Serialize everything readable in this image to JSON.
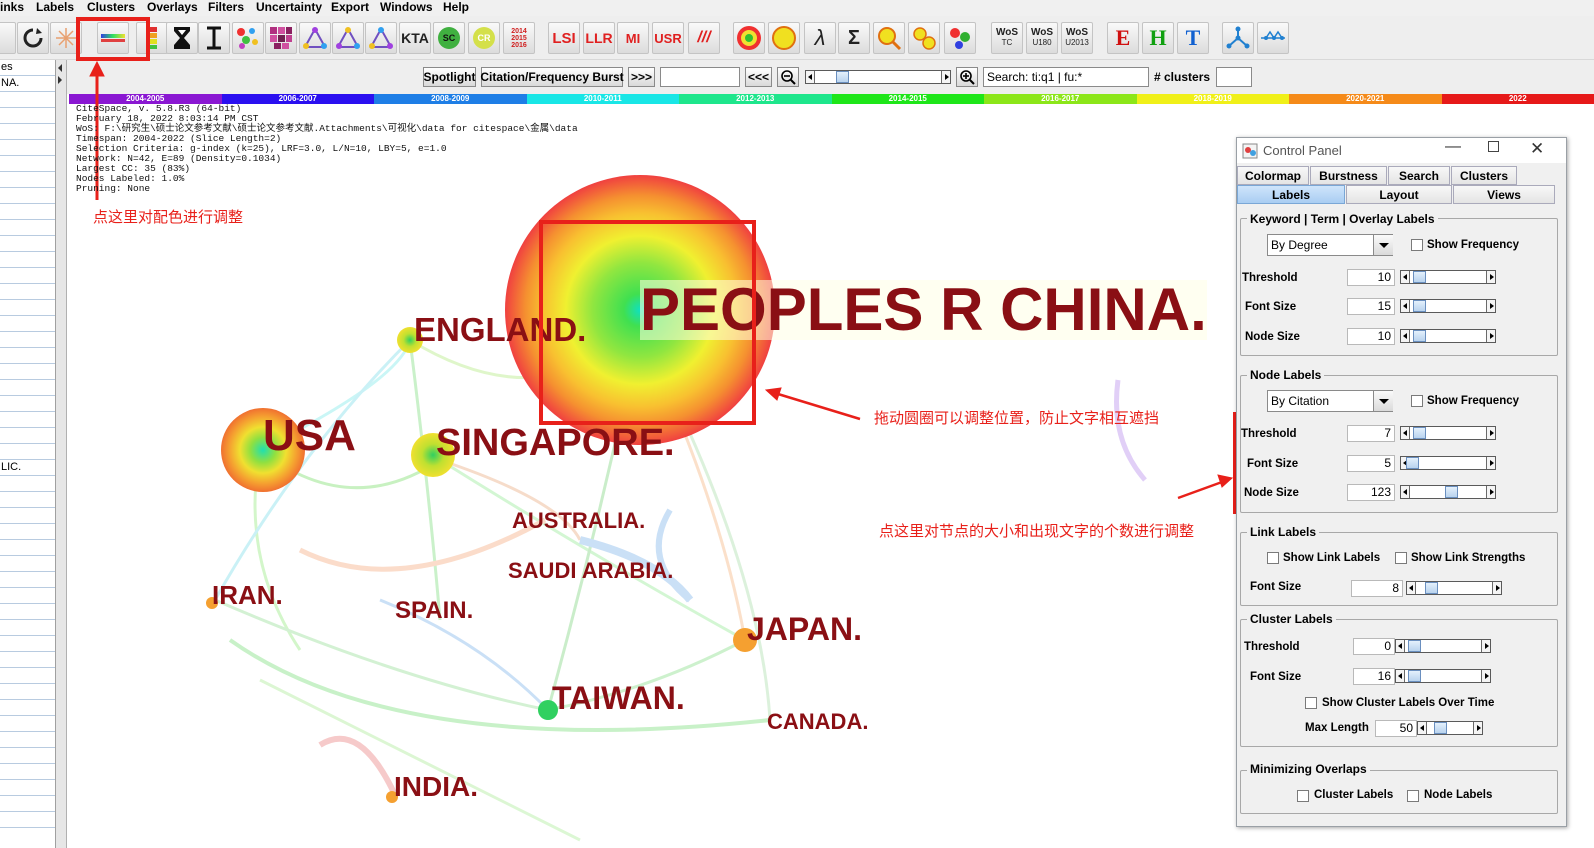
{
  "menu": [
    "inks",
    "Labels",
    "Clusters",
    "Overlays",
    "Filters",
    "Uncertainty",
    "Export",
    "Windows",
    "Help"
  ],
  "toolbar": {
    "buttons": [
      {
        "id": "refresh-button",
        "icon": "refresh-icon"
      },
      {
        "id": "sparkle-button",
        "icon": "sparkle-icon"
      },
      {
        "id": "colormap-button",
        "icon": "colormap-icon"
      },
      {
        "id": "palette-button",
        "icon": "palette-icon"
      },
      {
        "id": "hourglass-button",
        "icon": "hourglass-icon"
      },
      {
        "id": "ibeam-button",
        "icon": "ibeam-icon"
      },
      {
        "id": "scatter-button",
        "icon": "scatter-icon"
      },
      {
        "id": "grid-button",
        "icon": "grid-icon"
      },
      {
        "id": "tri1-button",
        "icon": "triangle-network-icon"
      },
      {
        "id": "tri2-button",
        "icon": "triangle-network-icon"
      },
      {
        "id": "tri3-button",
        "icon": "triangle-network-icon"
      },
      {
        "id": "kta-button",
        "icon": "kta-icon"
      },
      {
        "id": "sc-button",
        "icon": "sc-icon"
      },
      {
        "id": "cr-button",
        "icon": "cr-icon"
      },
      {
        "id": "timeline-button",
        "icon": "timeline-icon"
      }
    ],
    "kta_label": "KTA",
    "sc_label": "SC",
    "cr_label": "CR",
    "timeline_label": "2014\n2015\n2016",
    "lsi_label": "LSI",
    "llr_label": "LLR",
    "mi_label": "MI",
    "usr_label": "USR",
    "slash_label": "///",
    "lambda_label": "λ",
    "sigma_label": "Σ",
    "wos_tc_label": [
      "WoS",
      "TC"
    ],
    "wos_u180_label": [
      "WoS",
      "U180"
    ],
    "wos_u2013_label": [
      "WoS",
      "U2013"
    ],
    "e_label": "E",
    "h_label": "H",
    "t_label": "T"
  },
  "left_panel": {
    "rows": [
      "es",
      "NA.",
      "",
      "",
      "",
      "",
      "",
      "",
      "",
      "",
      "",
      "",
      "",
      "",
      "",
      "",
      "",
      "",
      "",
      "",
      "",
      "",
      "",
      "",
      "",
      "LIC.",
      "",
      "",
      "",
      "",
      "",
      "",
      "",
      "",
      "",
      "",
      "",
      "",
      "",
      "",
      "",
      "",
      "",
      "",
      "",
      "",
      "",
      ""
    ]
  },
  "nav": {
    "spotlight": "Spotlight",
    "burst": "Citation/Frequency Burst",
    "forward": ">>>",
    "back": "<<<",
    "search_value": "Search: ti:q1 | fu:*",
    "clusters_label": "# clusters"
  },
  "years": [
    "2004-2005",
    "2006-2007",
    "2008-2009",
    "2010-2011",
    "2012-2013",
    "2014-2015",
    "2016-2017",
    "2018-2019",
    "2020-2021",
    "2022"
  ],
  "year_colors": [
    "#8a17d2",
    "#2a0ff0",
    "#1e7ee6",
    "#19e6e6",
    "#1ee68c",
    "#1ee619",
    "#8ce619",
    "#f0f019",
    "#f58a19",
    "#e61919"
  ],
  "info_lines": [
    "CiteSpace, v. 5.8.R3 (64-bit)",
    "February 18, 2022 8:03:14 PM CST",
    "WoS: F:\\研究生\\硕士论文参考文献\\硕士论文参考文献.Attachments\\可视化\\data for citespace\\金属\\data",
    "Timespan: 2004-2022 (Slice Length=2)",
    "Selection Criteria: g-index (k=25), LRF=3.0, L/N=10, LBY=5, e=1.0",
    "Network: N=42, E=89 (Density=0.1034)",
    "Largest CC: 35 (83%)",
    "Nodes Labeled: 1.0%",
    "Pruning: None"
  ],
  "annotations": {
    "colormap_hint": "点这里对配色进行调整",
    "drag_hint": "拖动圆圈可以调整位置，防止文字相互遮挡",
    "node_hint": "点这里对节点的大小和出现文字的个数进行调整"
  },
  "countries": [
    {
      "key": "china",
      "label": "PEOPLES R CHINA."
    },
    {
      "key": "england",
      "label": "ENGLAND."
    },
    {
      "key": "usa",
      "label": "USA"
    },
    {
      "key": "singapore",
      "label": "SINGAPORE."
    },
    {
      "key": "australia",
      "label": "AUSTRALIA."
    },
    {
      "key": "saudi",
      "label": "SAUDI ARABIA."
    },
    {
      "key": "iran",
      "label": "IRAN."
    },
    {
      "key": "spain",
      "label": "SPAIN."
    },
    {
      "key": "japan",
      "label": "JAPAN."
    },
    {
      "key": "taiwan",
      "label": "TAIWAN."
    },
    {
      "key": "canada",
      "label": "CANADA."
    },
    {
      "key": "india",
      "label": "INDIA."
    }
  ],
  "control_panel": {
    "title": "Control Panel",
    "tabs_row1": [
      "Colormap",
      "Burstness",
      "Search",
      "Clusters"
    ],
    "tabs_row2": [
      "Labels",
      "Layout",
      "Views"
    ],
    "selected_tab": "Labels",
    "keyword_group": {
      "title": "Keyword | Term | Overlay Labels",
      "combo": "By Degree",
      "show_frequency": "Show Frequency",
      "threshold_label": "Threshold",
      "threshold": "10",
      "font_size_label": "Font Size",
      "font_size": "15",
      "node_size_label": "Node Size",
      "node_size": "10"
    },
    "node_group": {
      "title": "Node Labels",
      "combo": "By Citation",
      "show_frequency": "Show Frequency",
      "threshold_label": "Threshold",
      "threshold": "7",
      "font_size_label": "Font Size",
      "font_size": "5",
      "node_size_label": "Node Size",
      "node_size": "123"
    },
    "link_group": {
      "title": "Link Labels",
      "show_link_labels": "Show Link Labels",
      "show_link_strengths": "Show Link Strengths",
      "font_size_label": "Font Size",
      "font_size": "8"
    },
    "cluster_group": {
      "title": "Cluster Labels",
      "threshold_label": "Threshold",
      "threshold": "0",
      "font_size_label": "Font Size",
      "font_size": "16",
      "over_time": "Show Cluster Labels Over Time",
      "max_length_label": "Max Length",
      "max_length": "50"
    },
    "overlap_group": {
      "title": "Minimizing Overlaps",
      "cluster_labels": "Cluster Labels",
      "node_labels": "Node Labels"
    }
  }
}
